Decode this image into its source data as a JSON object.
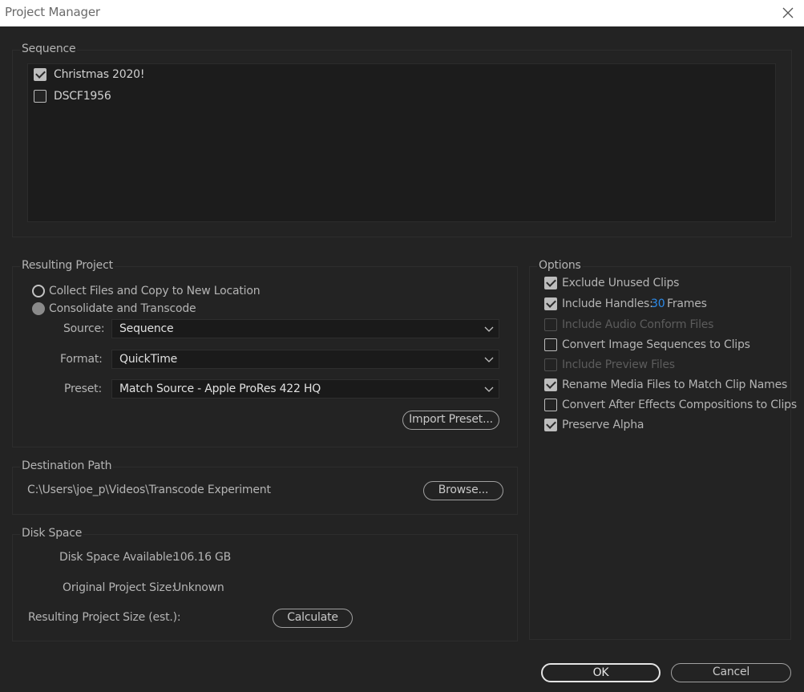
{
  "window": {
    "title": "Project Manager"
  },
  "sequence": {
    "title": "Sequence",
    "items": [
      {
        "label": "Christmas 2020!",
        "checked": true
      },
      {
        "label": "DSCF1956",
        "checked": false
      }
    ]
  },
  "resulting_project": {
    "title": "Resulting Project",
    "option_collect": "Collect Files and Copy to New Location",
    "option_consolidate": "Consolidate and Transcode",
    "source_label": "Source:",
    "source_value": "Sequence",
    "format_label": "Format:",
    "format_value": "QuickTime",
    "preset_label": "Preset:",
    "preset_value": "Match Source - Apple ProRes 422 HQ",
    "import_preset": "Import Preset..."
  },
  "destination": {
    "title": "Destination Path",
    "path": "C:\\Users\\joe_p\\Videos\\Transcode Experiment",
    "browse": "Browse..."
  },
  "disk": {
    "title": "Disk Space",
    "available_label": "Disk Space Available:",
    "available_value": "106.16 GB",
    "original_label": "Original Project Size:",
    "original_value": "Unknown",
    "resulting_label": "Resulting Project Size (est.):",
    "calculate": "Calculate"
  },
  "options": {
    "title": "Options",
    "exclude_unused": "Exclude Unused Clips",
    "include_handles": "Include Handles:",
    "handles_value": "30",
    "handles_unit": "Frames",
    "include_audio_conform": "Include Audio Conform Files",
    "convert_image_sequences": "Convert Image Sequences to Clips",
    "include_preview": "Include Preview Files",
    "rename_media": "Rename Media Files to Match Clip Names",
    "convert_ae": "Convert After Effects Compositions to Clips",
    "preserve_alpha": "Preserve Alpha"
  },
  "buttons": {
    "ok": "OK",
    "cancel": "Cancel"
  },
  "colors": {
    "accent": "#2d8ceb",
    "background": "#232323",
    "titlebar": "#ffffff"
  }
}
